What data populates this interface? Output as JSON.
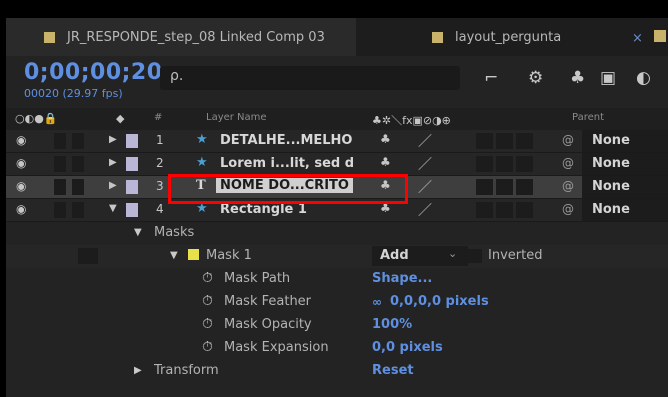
{
  "tabs": [
    {
      "label": "JR_RESPONDE_step_08 Linked Comp 03"
    },
    {
      "label": "layout_pergunta"
    }
  ],
  "tab_close_glyph": "×",
  "header": {
    "timecode": "0;00;00;20",
    "fps": "00020 (29.97 fps)",
    "search_glyph": "ρ.",
    "icons": [
      "comp-flowchart-icon",
      "draft-3d-icon",
      "shy-layers-icon",
      "frame-blending-icon",
      "motion-blur-icon"
    ]
  },
  "columns": {
    "hash": "#",
    "layer_name": "Layer Name",
    "parent": "Parent"
  },
  "layers": [
    {
      "num": "1",
      "name": "DETALHE...MELHO",
      "type": "shape",
      "expanded": false,
      "parent": "None"
    },
    {
      "num": "2",
      "name": "Lorem i...lit, sed d",
      "type": "shape",
      "expanded": false,
      "parent": "None"
    },
    {
      "num": "3",
      "name": "NOME DO...CRITO",
      "type": "text",
      "expanded": false,
      "parent": "None",
      "selected": true
    },
    {
      "num": "4",
      "name": "Rectangle 1",
      "type": "shape",
      "expanded": true,
      "parent": "None"
    }
  ],
  "text_layer_glyph": "T",
  "masks": {
    "group_label": "Masks",
    "mask_name": "Mask 1",
    "mode": "Add",
    "inverted_label": "Inverted",
    "properties": [
      {
        "label": "Mask Path",
        "value": "Shape..."
      },
      {
        "label": "Mask Feather",
        "value": "0,0,0,0 pixels"
      },
      {
        "label": "Mask Opacity",
        "value": "100%"
      },
      {
        "label": "Mask Expansion",
        "value": "0,0 pixels"
      }
    ]
  },
  "transform": {
    "label": "Transform",
    "value": "Reset"
  },
  "colors": {
    "accent_blue": "#5f8fe0",
    "label_lavender": "#b9b6d8",
    "label_gold": "#c9b26a",
    "mask_yellow": "#e8e04a",
    "highlight_red": "#ff0000"
  }
}
